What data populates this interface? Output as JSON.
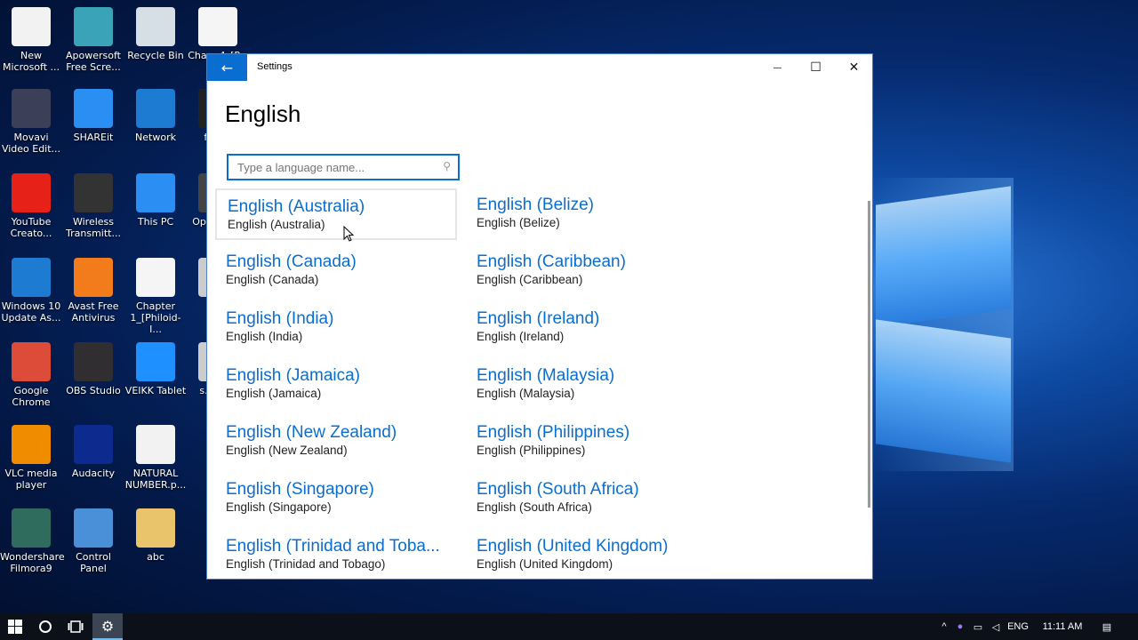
{
  "desktop": {
    "icons": [
      {
        "label": "New Microsoft ...",
        "icon": "powerpoint-file-icon",
        "color": "#f2f2f2"
      },
      {
        "label": "Apowersoft Free Scre...",
        "icon": "screen-recorder-icon",
        "color": "#3aa3b8"
      },
      {
        "label": "Recycle Bin",
        "icon": "recycle-bin-icon",
        "color": "#d7dfe6"
      },
      {
        "label": "Cha... 4_[P...",
        "icon": "pdf-icon",
        "color": "#f5f5f5"
      },
      {
        "label": "Movavi Video Edit...",
        "icon": "video-editor-icon",
        "color": "#3b3f57"
      },
      {
        "label": "SHAREit",
        "icon": "shareit-icon",
        "color": "#2a8ef2"
      },
      {
        "label": "Network",
        "icon": "network-icon",
        "color": "#1e7bd2"
      },
      {
        "label": "film...",
        "icon": "filmora-icon",
        "color": "#222"
      },
      {
        "label": "YouTube Creato...",
        "icon": "youtube-icon",
        "color": "#e62117"
      },
      {
        "label": "Wireless Transmitt...",
        "icon": "wireless-transmitter-icon",
        "color": "#333"
      },
      {
        "label": "This PC",
        "icon": "this-pc-icon",
        "color": "#2a8ef2"
      },
      {
        "label": "Op... Vid...",
        "icon": "app-icon",
        "color": "#444"
      },
      {
        "label": "Windows 10 Update As...",
        "icon": "windows-update-icon",
        "color": "#1e7bd2"
      },
      {
        "label": "Avast Free Antivirus",
        "icon": "avast-icon",
        "color": "#f27b1b"
      },
      {
        "label": "Chapter 1_[Philoid-I...",
        "icon": "pdf-icon",
        "color": "#f5f5f5"
      },
      {
        "label": "r...",
        "icon": "file-icon",
        "color": "#ccc"
      },
      {
        "label": "Google Chrome",
        "icon": "chrome-icon",
        "color": "#dd4b39"
      },
      {
        "label": "OBS Studio",
        "icon": "obs-icon",
        "color": "#302e31"
      },
      {
        "label": "VEIKK Tablet",
        "icon": "veikk-icon",
        "color": "#1e90ff"
      },
      {
        "label": "s... re...",
        "icon": "file-icon",
        "color": "#ccc"
      },
      {
        "label": "VLC media player",
        "icon": "vlc-icon",
        "color": "#f08c00"
      },
      {
        "label": "Audacity",
        "icon": "audacity-icon",
        "color": "#0d2a8f"
      },
      {
        "label": "NATURAL NUMBER.p...",
        "icon": "powerpoint-file-icon",
        "color": "#f2f2f2"
      },
      {
        "label": "Wondershare Filmora9",
        "icon": "filmora-icon",
        "color": "#2f6c5e"
      },
      {
        "label": "Control Panel",
        "icon": "control-panel-icon",
        "color": "#4a90d9"
      },
      {
        "label": "abc",
        "icon": "folder-icon",
        "color": "#e9c46a"
      }
    ]
  },
  "window": {
    "title": "Settings",
    "back_icon": "←",
    "min_icon": "—",
    "max_icon": "☐",
    "close_icon": "✕",
    "page_title": "English",
    "search_placeholder": "Type a language name...",
    "search_icon": "⚲",
    "languages": [
      {
        "name": "English (Australia)",
        "sub": "English (Australia)"
      },
      {
        "name": "English (Belize)",
        "sub": "English (Belize)"
      },
      {
        "name": "English (Canada)",
        "sub": "English (Canada)"
      },
      {
        "name": "English (Caribbean)",
        "sub": "English (Caribbean)"
      },
      {
        "name": "English (India)",
        "sub": "English (India)"
      },
      {
        "name": "English (Ireland)",
        "sub": "English (Ireland)"
      },
      {
        "name": "English (Jamaica)",
        "sub": "English (Jamaica)"
      },
      {
        "name": "English (Malaysia)",
        "sub": "English (Malaysia)"
      },
      {
        "name": "English (New Zealand)",
        "sub": "English (New Zealand)"
      },
      {
        "name": "English (Philippines)",
        "sub": "English (Philippines)"
      },
      {
        "name": "English (Singapore)",
        "sub": "English (Singapore)"
      },
      {
        "name": "English (South Africa)",
        "sub": "English (South Africa)"
      },
      {
        "name": "English (Trinidad and Toba...",
        "sub": "English (Trinidad and Tobago)"
      },
      {
        "name": "English (United Kingdom)",
        "sub": "English (United Kingdom)"
      }
    ]
  },
  "taskbar": {
    "start_icon": "windows-start-icon",
    "search_icon": "cortana-icon",
    "task_view_icon": "task-view-icon",
    "settings_icon": "⚙",
    "tray": {
      "chevron": "^",
      "language": "ENG",
      "time": "11:11 AM"
    }
  }
}
